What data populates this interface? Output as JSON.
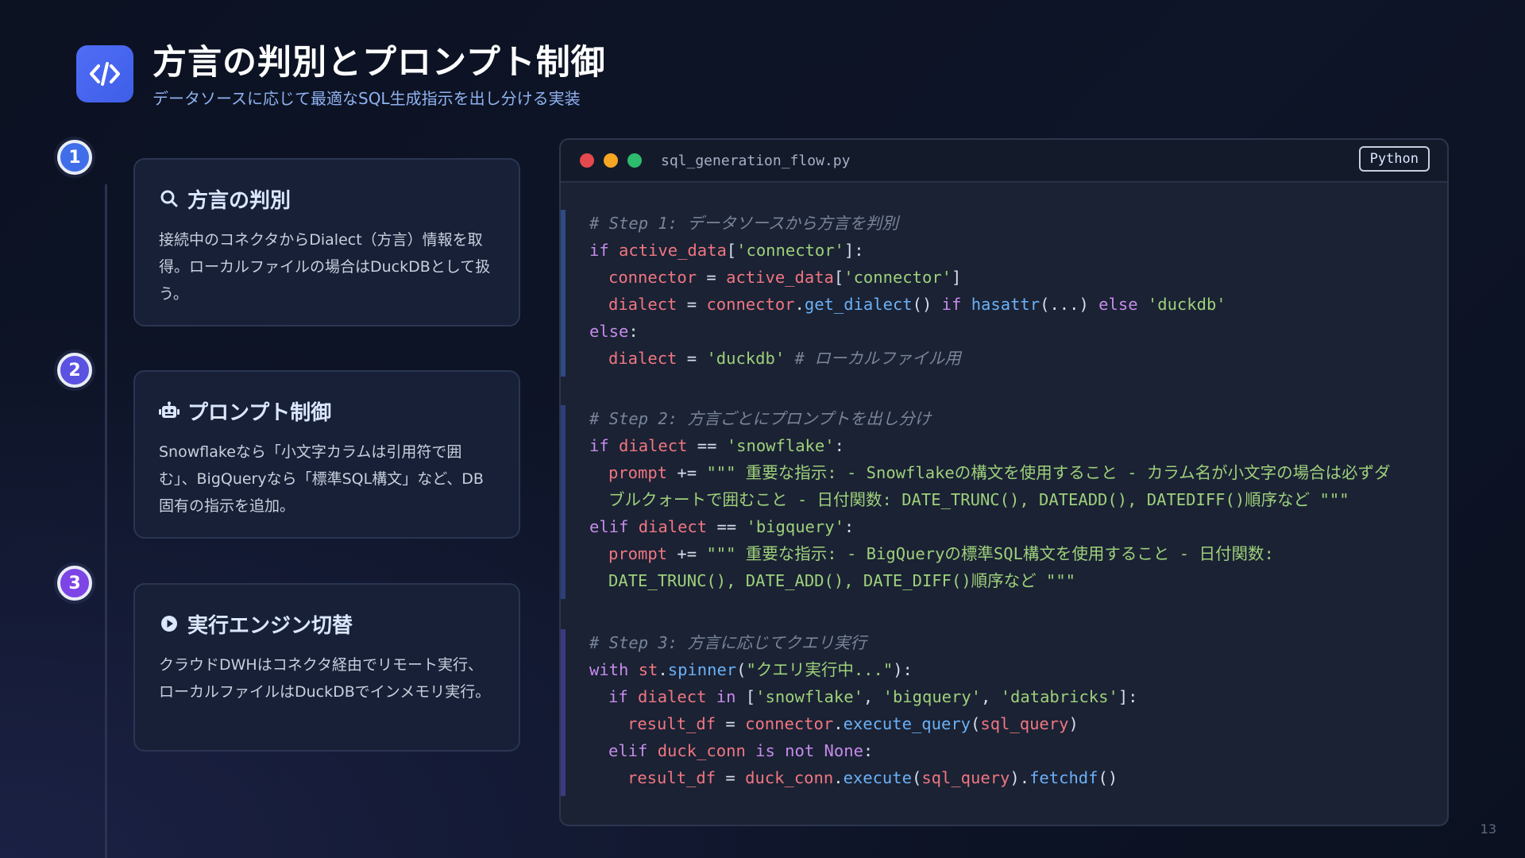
{
  "header": {
    "title": "方言の判別とプロンプト制御",
    "subtitle": "データソースに応じて最適なSQL生成指示を出し分ける実装",
    "icon": "code-icon"
  },
  "steps": [
    {
      "number": "1",
      "title": "方言の判別",
      "icon": "search-icon",
      "description": "接続中のコネクタからDialect（方言）情報を取得。ローカルファイルの場合はDuckDBとして扱う。",
      "color": "#3f6ee8"
    },
    {
      "number": "2",
      "title": "プロンプト制御",
      "icon": "robot-icon",
      "description": "Snowflakeなら「小文字カラムは引用符で囲む」、BigQueryなら「標準SQL構文」など、DB固有の指示を追加。",
      "color": "#5a52e0"
    },
    {
      "number": "3",
      "title": "実行エンジン切替",
      "icon": "play-circle-icon",
      "description": "クラウドDWHはコネクタ経由でリモート実行、ローカルファイルはDuckDBでインメモリ実行。",
      "color": "#7d45e6"
    }
  ],
  "code": {
    "filename": "sql_generation_flow.py",
    "language": "Python",
    "window_dots": [
      "#e5484d",
      "#f5a623",
      "#2dbb6e"
    ],
    "s1": {
      "comment": "# Step 1: データソースから方言を判別",
      "l1": [
        "if",
        "active_data",
        "[",
        "'connector'",
        "]:"
      ],
      "l2": [
        "connector",
        " = ",
        "active_data",
        "[",
        "'connector'",
        "]"
      ],
      "l3": [
        "dialect",
        " = ",
        "connector",
        ".",
        "get_dialect",
        "() ",
        "if",
        " ",
        "hasattr",
        "(...) ",
        "else",
        " ",
        "'duckdb'"
      ],
      "l4": [
        "else",
        ":"
      ],
      "l5": [
        "dialect",
        " = ",
        "'duckdb'",
        " ",
        "# ローカルファイル用"
      ]
    },
    "s2": {
      "comment": "# Step 2: 方言ごとにプロンプトを出し分け",
      "l1": [
        "if",
        " ",
        "dialect",
        " == ",
        "'snowflake'",
        ":"
      ],
      "l2": [
        "prompt",
        " += ",
        "\"\"\" 重要な指示: - Snowflakeの構文を使用すること - カラム名が小文字の場合は必ずダ"
      ],
      "l3": [
        "ブルクォートで囲むこと - 日付関数: DATE_TRUNC(), DATEADD(), DATEDIFF()順序など \"\"\""
      ],
      "l4": [
        "elif",
        " ",
        "dialect",
        " == ",
        "'bigquery'",
        ":"
      ],
      "l5": [
        "prompt",
        " += ",
        "\"\"\" 重要な指示: - BigQueryの標準SQL構文を使用すること - 日付関数:"
      ],
      "l6": [
        "DATE_TRUNC(), DATE_ADD(), DATE_DIFF()順序など \"\"\""
      ]
    },
    "s3": {
      "comment": "# Step 3: 方言に応じてクエリ実行",
      "l1": [
        "with",
        " ",
        "st",
        ".",
        "spinner",
        "(",
        "\"クエリ実行中...\"",
        "):"
      ],
      "l2": [
        "if",
        " ",
        "dialect",
        " ",
        "in",
        " [",
        "'snowflake'",
        ", ",
        "'bigquery'",
        ", ",
        "'databricks'",
        "]:"
      ],
      "l3": [
        "result_df",
        " = ",
        "connector",
        ".",
        "execute_query",
        "(",
        "sql_query",
        ")"
      ],
      "l4": [
        "elif",
        " ",
        "duck_conn",
        " ",
        "is not None",
        ":"
      ],
      "l5": [
        "result_df",
        " = ",
        "duck_conn",
        ".",
        "execute",
        "(",
        "sql_query",
        ").",
        "fetchdf",
        "()"
      ]
    }
  },
  "page_number": "13"
}
